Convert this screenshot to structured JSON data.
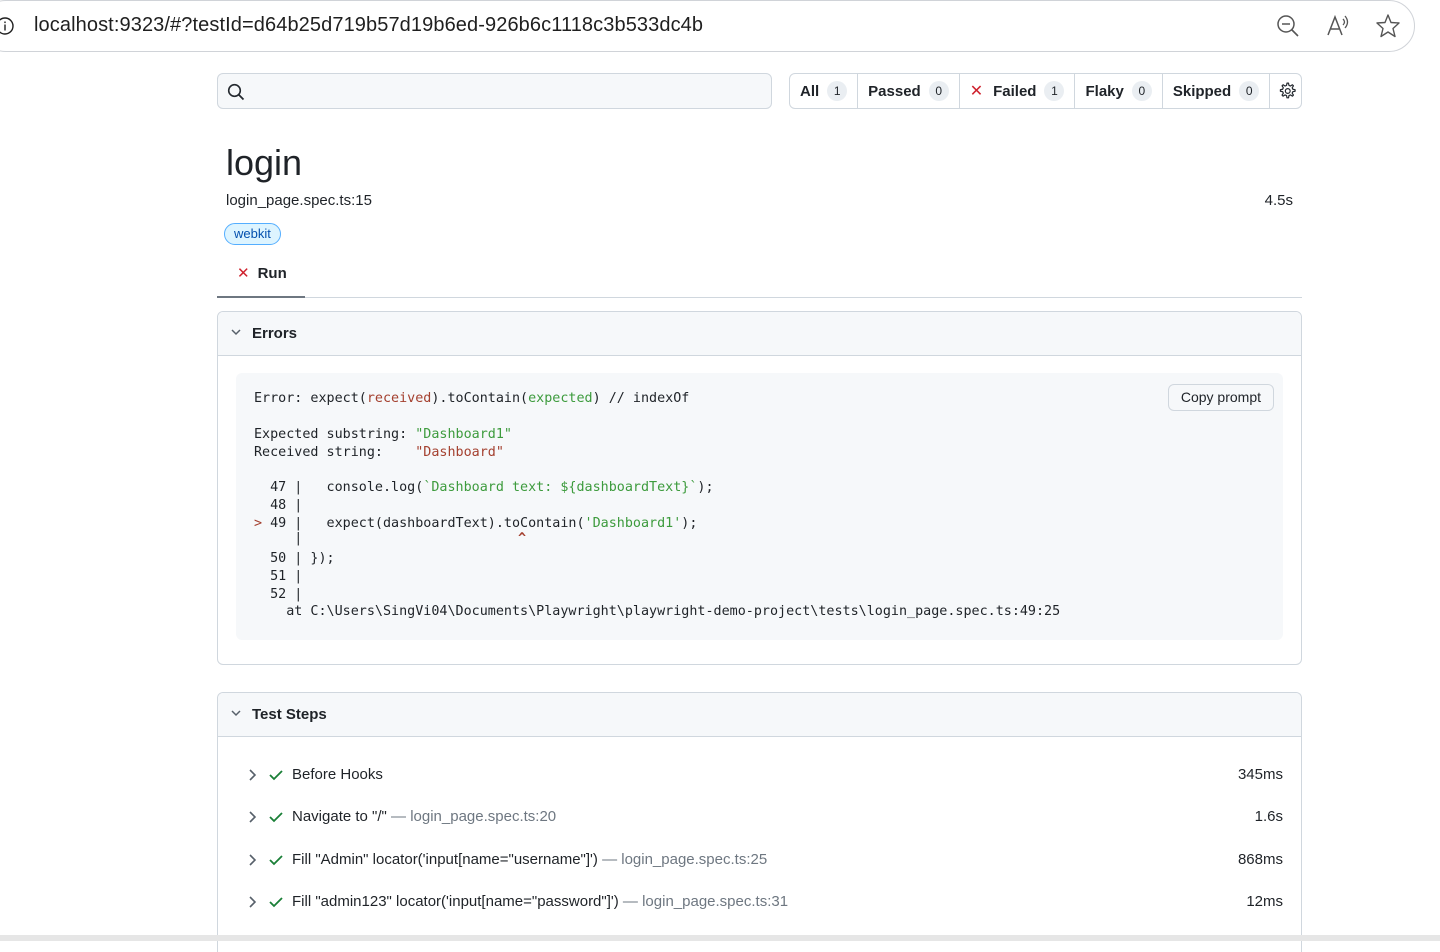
{
  "browser": {
    "url": "localhost:9323/#?testId=d64b25d719b57d19b6ed-926b6c1118c3b533dc4b",
    "icons": [
      "info-icon",
      "zoom-out-icon",
      "read-aloud-icon",
      "favorite-star-icon"
    ]
  },
  "search": {
    "placeholder": ""
  },
  "filters": [
    {
      "label": "All",
      "count": "1"
    },
    {
      "label": "Passed",
      "count": "0"
    },
    {
      "label": "Failed",
      "count": "1"
    },
    {
      "label": "Flaky",
      "count": "0"
    },
    {
      "label": "Skipped",
      "count": "0"
    }
  ],
  "test": {
    "title": "login",
    "location": "login_page.spec.ts:15",
    "duration": "4.5s",
    "tag": "webkit",
    "tab": "Run"
  },
  "errors": {
    "heading": "Errors",
    "copy_button": "Copy prompt",
    "lines": {
      "l1_prefix": "Error: expect(",
      "l1_received": "received",
      "l1_mid": ").toContain(",
      "l1_expected": "expected",
      "l1_suffix": ") // indexOf",
      "l2_label": "Expected substring: ",
      "l2_value": "\"Dashboard1\"",
      "l3_label": "Received string:    ",
      "l3_value": "\"Dashboard\"",
      "c47_prefix": "  47 |   console.log(",
      "c47_string": "`Dashboard text: ${dashboardText}`",
      "c47_suffix": ");",
      "c48": "  48 |",
      "c49_marker": ">",
      "c49_prefix": " 49 |   expect(dashboardText).toContain(",
      "c49_string": "'Dashboard1'",
      "c49_suffix": ");",
      "caret_bar": "     |",
      "caret": "^",
      "c50": "  50 | });",
      "c51": "  51 |",
      "c52": "  52 |",
      "at": "    at C:\\Users\\SingVi04\\Documents\\Playwright\\playwright-demo-project\\tests\\login_page.spec.ts:49:25"
    }
  },
  "steps": {
    "heading": "Test Steps",
    "items": [
      {
        "label": "Before Hooks",
        "location": "",
        "time": "345ms"
      },
      {
        "label": "Navigate to \"/\"",
        "location": " — login_page.spec.ts:20",
        "time": "1.6s"
      },
      {
        "label": "Fill \"Admin\" locator('input[name=\"username\"]')",
        "location": " — login_page.spec.ts:25",
        "time": "868ms"
      },
      {
        "label": "Fill \"admin123\" locator('input[name=\"password\"]')",
        "location": " — login_page.spec.ts:31",
        "time": "12ms"
      }
    ]
  },
  "colors": {
    "failed": "#cf222e",
    "passed_check": "#1a7f37",
    "tag_bg": "#ddf4ff",
    "tag_border": "#54aeff"
  }
}
